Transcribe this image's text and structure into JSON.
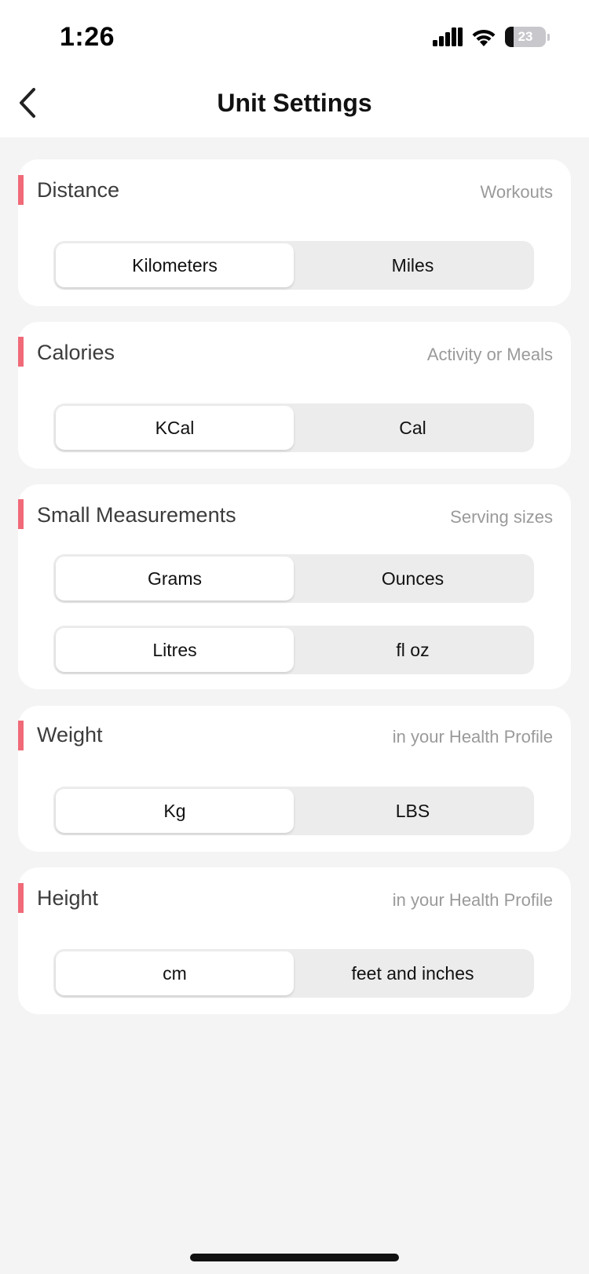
{
  "status_bar": {
    "time": "1:26",
    "battery_level": "23"
  },
  "header": {
    "title": "Unit Settings",
    "back_icon": "chevron-left-icon"
  },
  "accent_color": "#f06a78",
  "sections": [
    {
      "title": "Distance",
      "subtitle": "Workouts",
      "toggles": [
        {
          "options": [
            "Kilometers",
            "Miles"
          ],
          "selected": "Kilometers"
        }
      ]
    },
    {
      "title": "Calories",
      "subtitle": "Activity or Meals",
      "toggles": [
        {
          "options": [
            "KCal",
            "Cal"
          ],
          "selected": "KCal"
        }
      ]
    },
    {
      "title": "Small Measurements",
      "subtitle": "Serving sizes",
      "toggles": [
        {
          "options": [
            "Grams",
            "Ounces"
          ],
          "selected": "Grams"
        },
        {
          "options": [
            "Litres",
            "fl oz"
          ],
          "selected": "Litres"
        }
      ]
    },
    {
      "title": "Weight",
      "subtitle": "in your Health Profile",
      "toggles": [
        {
          "options": [
            "Kg",
            "LBS"
          ],
          "selected": "Kg"
        }
      ]
    },
    {
      "title": "Height",
      "subtitle": "in your Health Profile",
      "toggles": [
        {
          "options": [
            "cm",
            "feet and inches"
          ],
          "selected": "cm"
        }
      ]
    }
  ]
}
